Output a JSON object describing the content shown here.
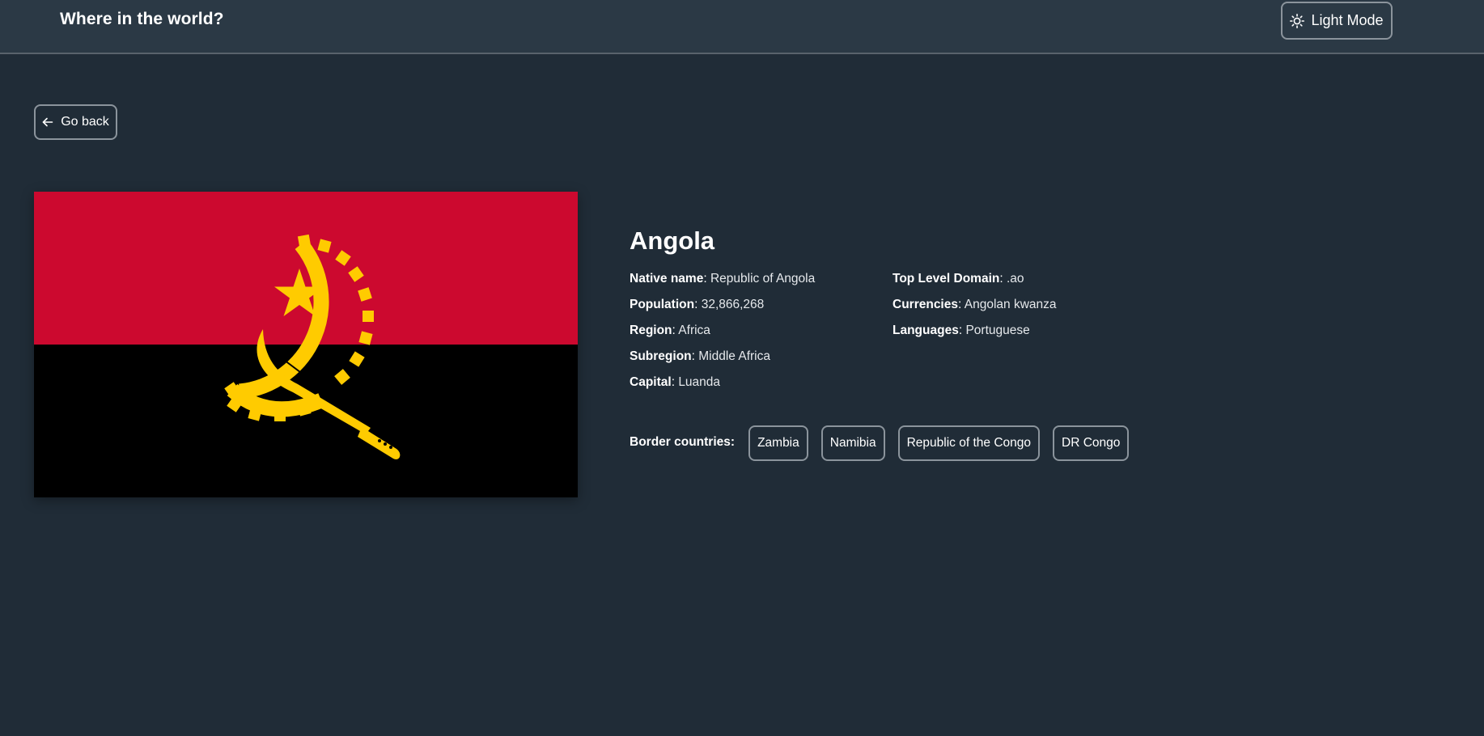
{
  "header": {
    "title": "Where in the world?",
    "theme_toggle": {
      "icon": "sun-icon",
      "label": "Light Mode"
    }
  },
  "navigation": {
    "back_icon": "arrow-left-icon",
    "back_label": "Go back"
  },
  "country": {
    "name": "Angola",
    "flag": {
      "description_icon": "angola-flag",
      "colors": {
        "top_band": "#cc092f",
        "bottom_band": "#000000",
        "emblem": "#ffcb00"
      }
    },
    "info_left": [
      {
        "key": "Native name",
        "sep": ": ",
        "value": "Republic of Angola"
      },
      {
        "key": "Population",
        "sep": ": ",
        "value": "32,866,268"
      },
      {
        "key": "Region",
        "sep": ": ",
        "value": "Africa"
      },
      {
        "key": "Subregion",
        "sep": ": ",
        "value": "Middle Africa"
      },
      {
        "key": "Capital",
        "sep": ": ",
        "value": "Luanda"
      }
    ],
    "info_right": [
      {
        "key": "Top Level Domain",
        "sep": ": ",
        "value": ".ao"
      },
      {
        "key": "Currencies",
        "sep": ": ",
        "value": "Angolan kwanza"
      },
      {
        "key": "Languages",
        "sep": ": ",
        "value": "Portuguese"
      }
    ],
    "borders_label": "Border countries:",
    "borders": [
      "Zambia",
      "Namibia",
      "Republic of the Congo",
      "DR Congo"
    ]
  },
  "theme": {
    "background": "#202c37",
    "header_background": "#2b3945",
    "text": "#ffffff",
    "border": "#8b949c"
  }
}
